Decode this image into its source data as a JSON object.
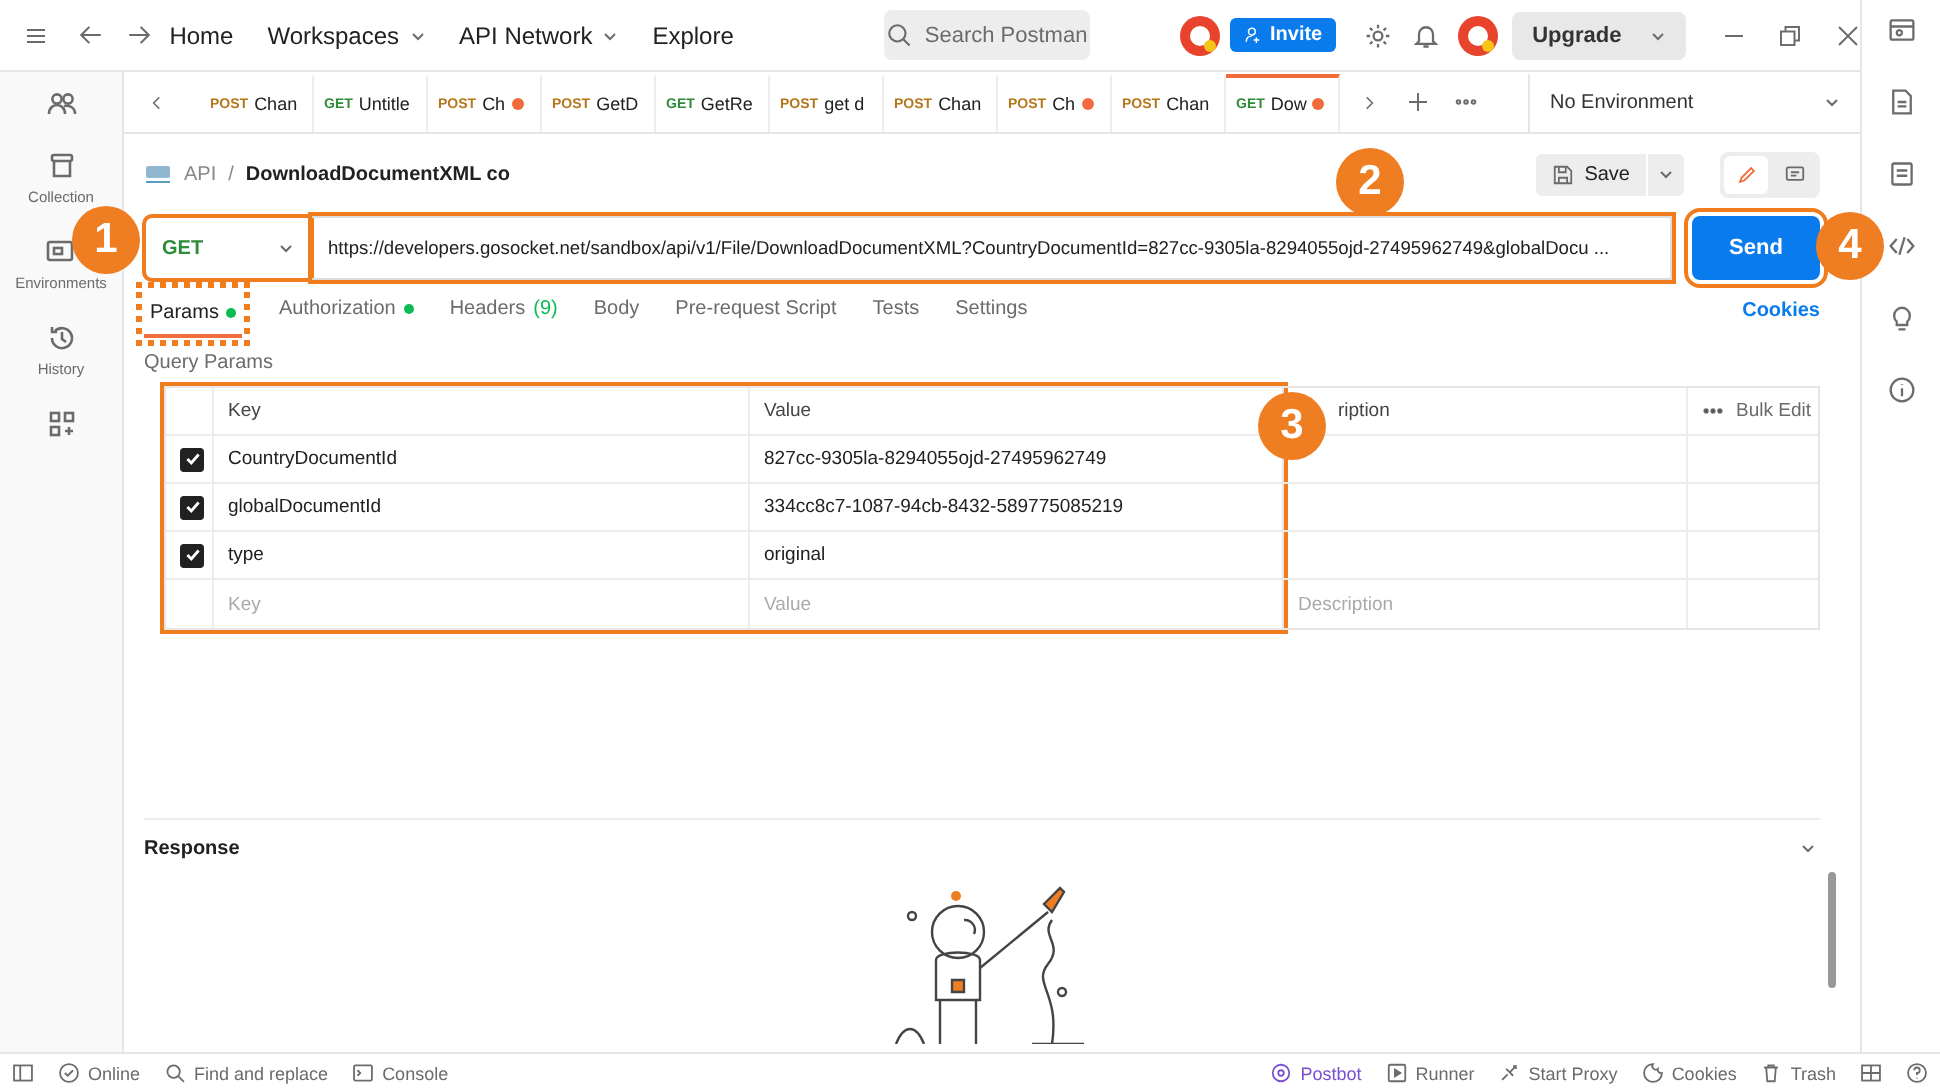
{
  "top_bar": {
    "nav": [
      {
        "label": "Home",
        "dropdown": false
      },
      {
        "label": "Workspaces",
        "dropdown": true
      },
      {
        "label": "API Network",
        "dropdown": true
      },
      {
        "label": "Explore",
        "dropdown": false
      }
    ],
    "search": {
      "placeholder": "Search Postman"
    },
    "invite": "Invite",
    "upgrade": "Upgrade"
  },
  "sidebar": {
    "items": [
      {
        "kind": "team"
      },
      {
        "kind": "collections",
        "label": "Collection"
      },
      {
        "kind": "environments",
        "label": "Environments"
      },
      {
        "kind": "history",
        "label": "History"
      },
      {
        "kind": "apps"
      }
    ]
  },
  "tabs": [
    {
      "method": "POST",
      "name": "Chan",
      "unsaved": false,
      "selected": false
    },
    {
      "method": "GET",
      "name": "Untitle",
      "unsaved": false,
      "selected": false
    },
    {
      "method": "POST",
      "name": "Ch",
      "unsaved": true,
      "selected": false
    },
    {
      "method": "POST",
      "name": "GetD",
      "unsaved": false,
      "selected": false
    },
    {
      "method": "GET",
      "name": "GetRe",
      "unsaved": false,
      "selected": false
    },
    {
      "method": "POST",
      "name": "get d",
      "unsaved": false,
      "selected": false
    },
    {
      "method": "POST",
      "name": "Chan",
      "unsaved": false,
      "selected": false
    },
    {
      "method": "POST",
      "name": "Ch",
      "unsaved": true,
      "selected": false
    },
    {
      "method": "POST",
      "name": "Chan",
      "unsaved": false,
      "selected": false
    },
    {
      "method": "GET",
      "name": "Dow",
      "unsaved": true,
      "selected": true
    }
  ],
  "environment": "No Environment",
  "request": {
    "breadcrumb": [
      "API",
      "/",
      "DownloadDocumentXML co"
    ],
    "save": "Save",
    "method": "GET",
    "url": "https://developers.gosocket.net/sandbox/api/v1/File/DownloadDocumentXML?CountryDocumentId=827cc-9305la-8294055ojd-27495962749&globalDocu ...",
    "send": "Send"
  },
  "request_tabs": [
    {
      "label": "Params",
      "dot": true,
      "selected": true
    },
    {
      "label": "Authorization",
      "dot": true,
      "selected": false
    },
    {
      "label": "Headers",
      "count": "(9)",
      "dot": false,
      "selected": false
    },
    {
      "label": "Body",
      "dot": false,
      "selected": false
    },
    {
      "label": "Pre-request Script",
      "dot": false,
      "selected": false
    },
    {
      "label": "Tests",
      "dot": false,
      "selected": false
    },
    {
      "label": "Settings",
      "dot": false,
      "selected": false
    }
  ],
  "cookies_link": "Cookies",
  "query_params": {
    "title": "Query Params",
    "columns": [
      "Key",
      "Value",
      "ription"
    ],
    "bulk_edit": "Bulk Edit",
    "rows": [
      {
        "checked": true,
        "key": "CountryDocumentId",
        "value": "827cc-9305la-8294055ojd-27495962749"
      },
      {
        "checked": true,
        "key": "globalDocumentId",
        "value": "334cc8c7-1087-94cb-8432-589775085219"
      },
      {
        "checked": true,
        "key": "type",
        "value": "original"
      }
    ],
    "empty_row": {
      "key": "Key",
      "value": "Value",
      "description": "Description"
    }
  },
  "response": {
    "title": "Response"
  },
  "status_bar": {
    "left": [
      {
        "kind": "online",
        "label": "Online"
      },
      {
        "kind": "find",
        "label": "Find and replace"
      },
      {
        "kind": "console",
        "label": "Console"
      }
    ],
    "right": [
      {
        "kind": "postbot",
        "label": "Postbot"
      },
      {
        "kind": "runner",
        "label": "Runner"
      },
      {
        "kind": "proxy",
        "label": "Start Proxy"
      },
      {
        "kind": "cookies",
        "label": "Cookies"
      },
      {
        "kind": "trash",
        "label": "Trash"
      }
    ]
  },
  "callouts": [
    "1",
    "2",
    "3",
    "4"
  ]
}
